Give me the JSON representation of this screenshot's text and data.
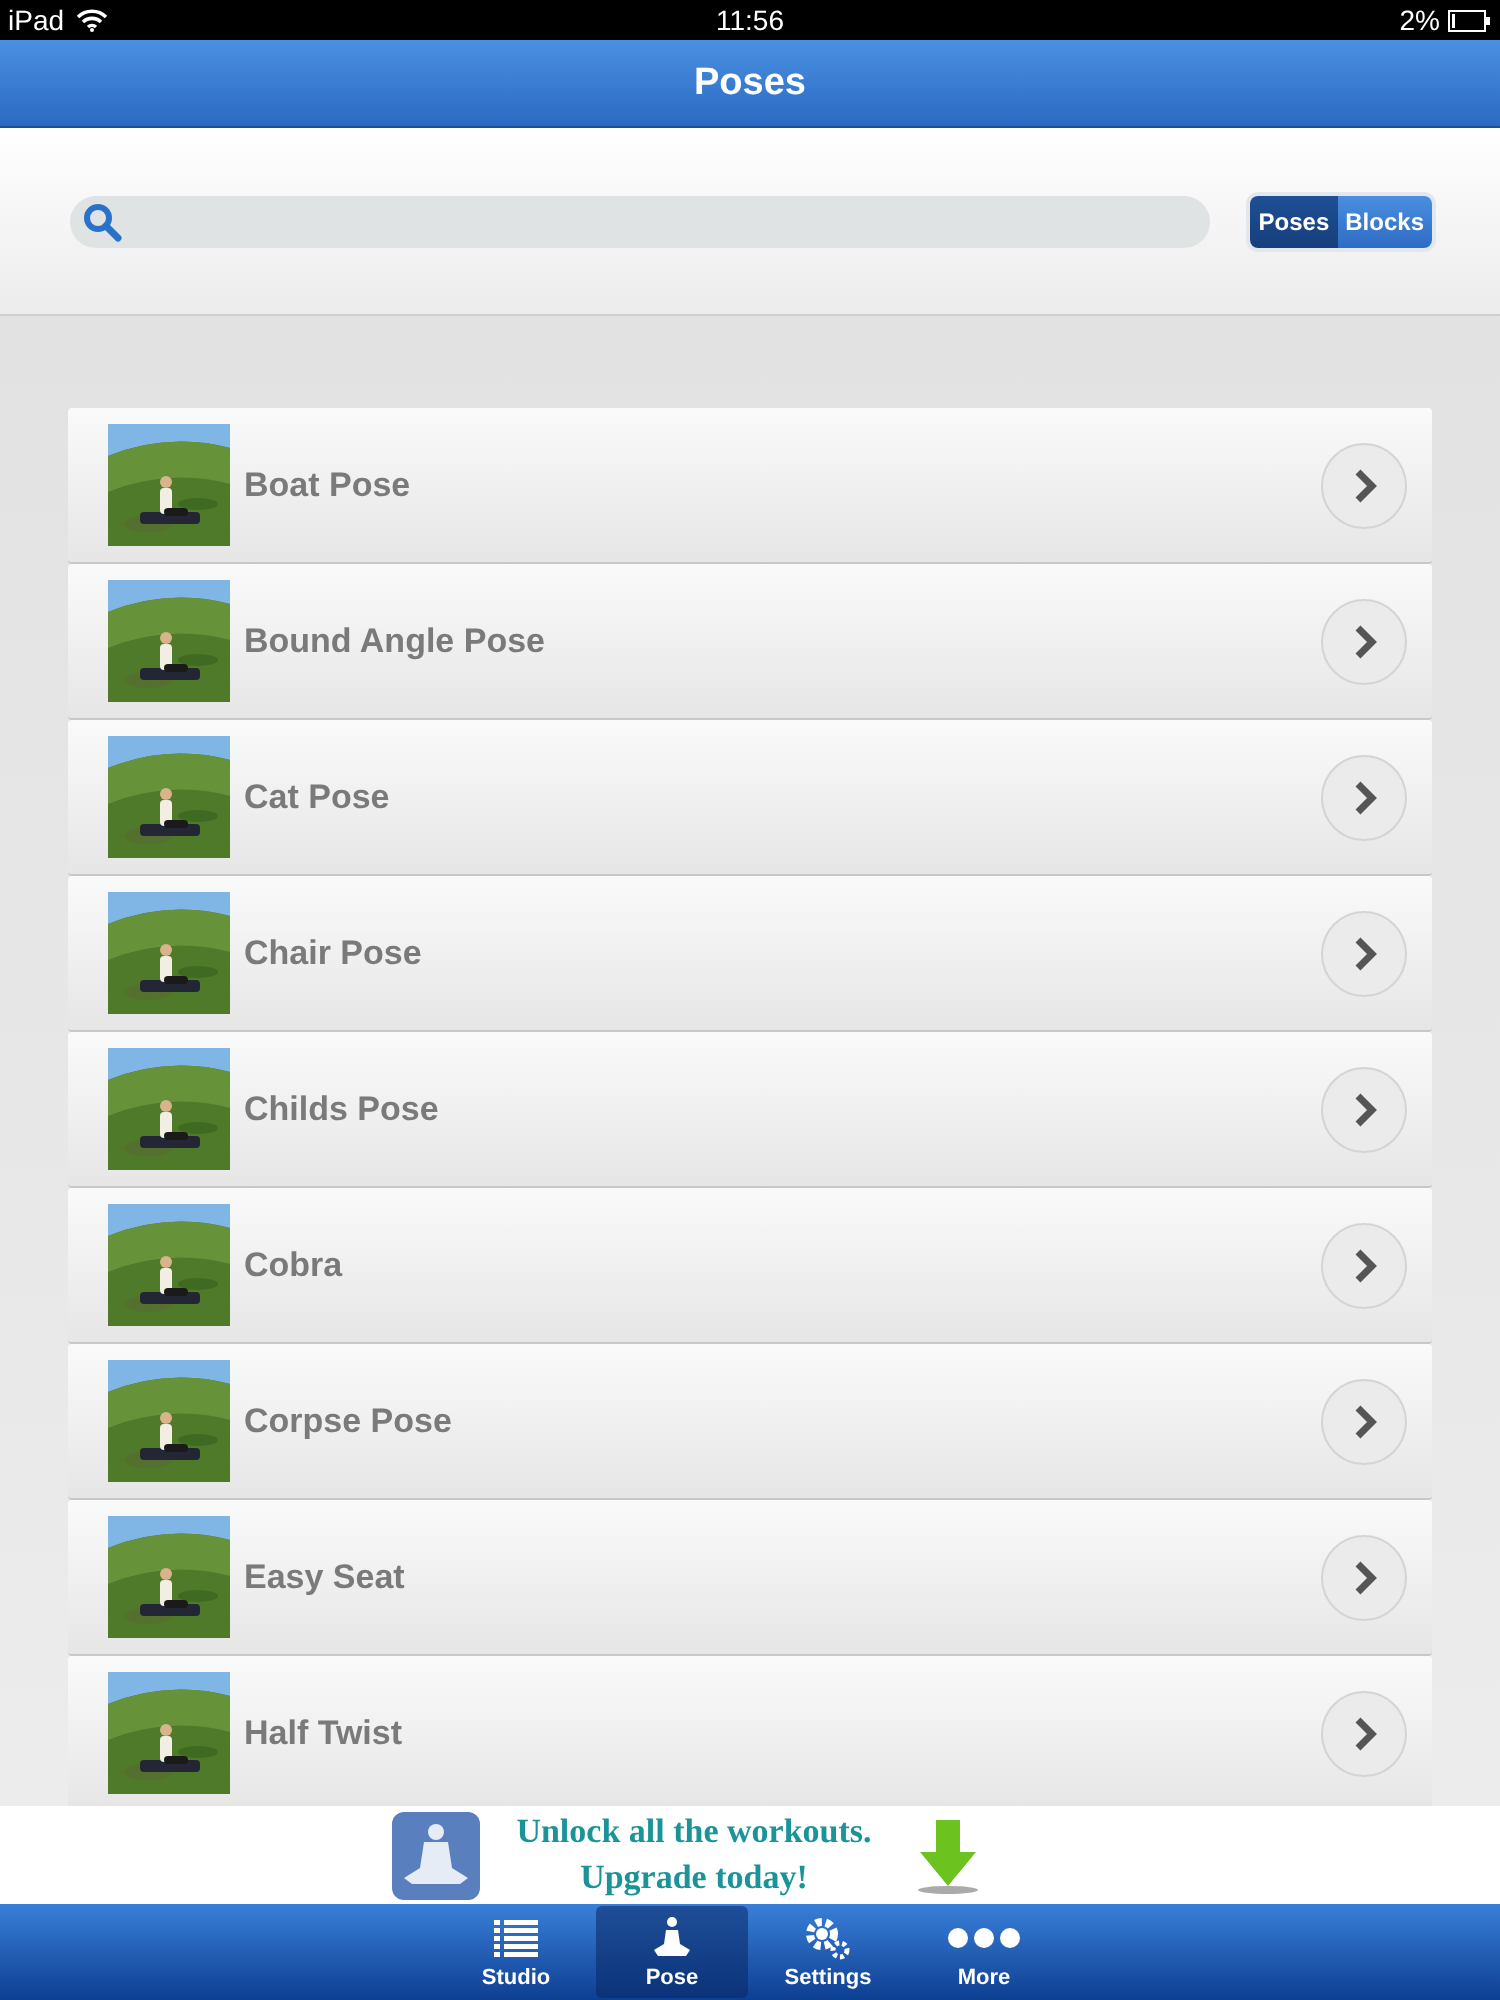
{
  "status_bar": {
    "device": "iPad",
    "time": "11:56",
    "battery": "2%"
  },
  "nav_bar": {
    "title": "Poses"
  },
  "segments": [
    {
      "label": "Poses",
      "selected": true
    },
    {
      "label": "Blocks",
      "selected": false
    }
  ],
  "poses": [
    {
      "name": "Boat Pose"
    },
    {
      "name": "Bound Angle Pose"
    },
    {
      "name": "Cat Pose"
    },
    {
      "name": "Chair Pose"
    },
    {
      "name": "Childs Pose"
    },
    {
      "name": "Cobra"
    },
    {
      "name": "Corpse Pose"
    },
    {
      "name": "Easy Seat"
    },
    {
      "name": "Half Twist"
    }
  ],
  "ad_banner": {
    "lines": [
      "Unlock all the workouts.",
      "Upgrade today!"
    ]
  },
  "tab_bar": [
    {
      "label": "Studio",
      "kind": "list",
      "selected": false
    },
    {
      "label": "Pose",
      "kind": "meditation",
      "selected": true
    },
    {
      "label": "Settings",
      "kind": "gears",
      "selected": false
    },
    {
      "label": "More",
      "kind": "dots",
      "selected": false
    }
  ]
}
